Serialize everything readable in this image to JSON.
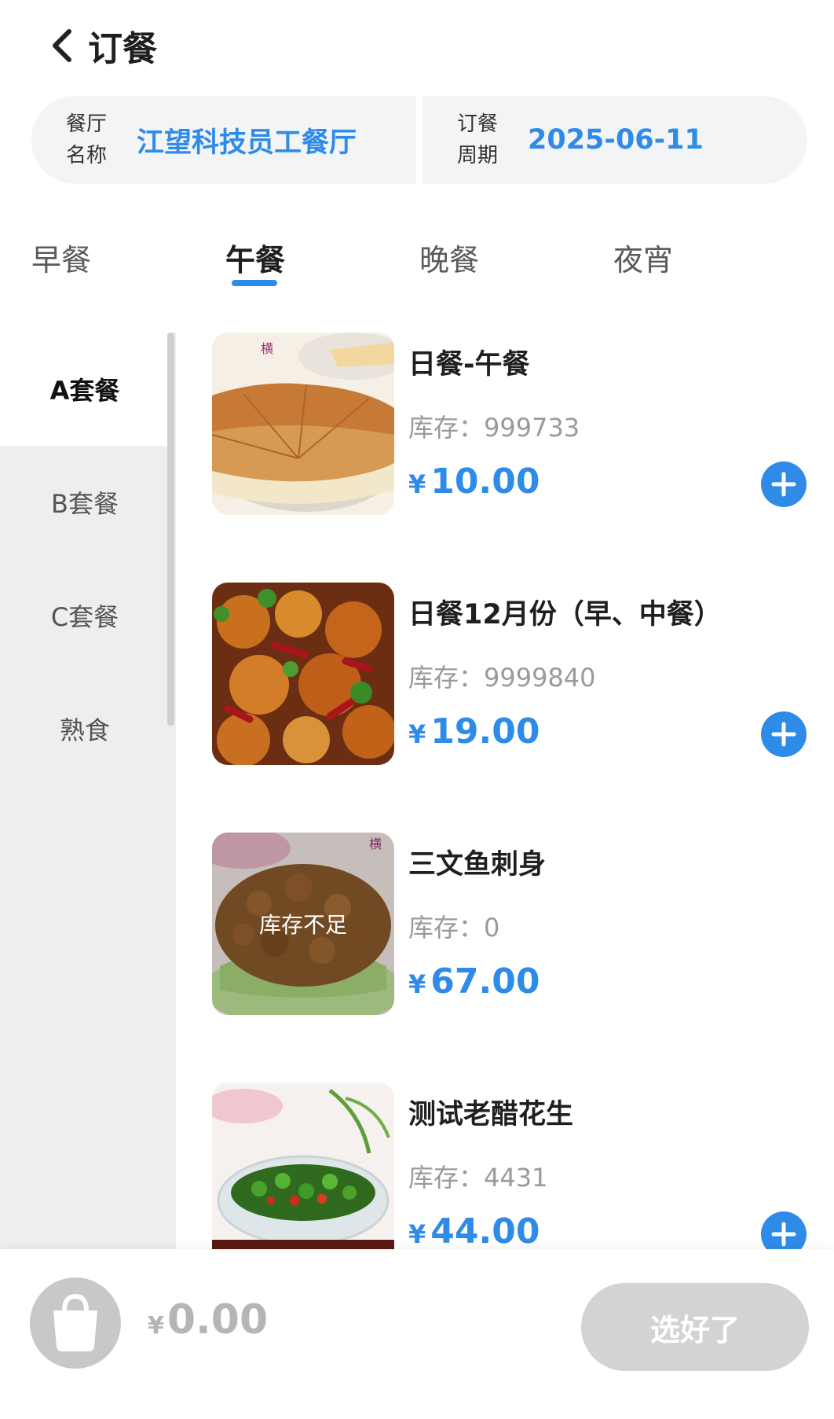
{
  "header": {
    "title": "订餐"
  },
  "info": {
    "restaurant_label": "餐厅名称",
    "restaurant_name": "江望科技员工餐厅",
    "period_label": "订餐周期",
    "period_value": "2025-06-11"
  },
  "tabs": [
    {
      "label": "早餐"
    },
    {
      "label": "午餐",
      "active": true
    },
    {
      "label": "晚餐"
    },
    {
      "label": "夜宵"
    }
  ],
  "categories": [
    {
      "label": "A套餐",
      "active": true
    },
    {
      "label": "B套餐"
    },
    {
      "label": "C套餐"
    },
    {
      "label": "熟食"
    }
  ],
  "items": [
    {
      "name": "日餐-午餐",
      "stock": "库存：999733",
      "currency": "¥",
      "price": "10.00",
      "image": "cake-photo-icon"
    },
    {
      "name": "日餐12月份（早、中餐）",
      "stock": "库存：9999840",
      "currency": "¥",
      "price": "19.00",
      "image": "fried-dish-photo-icon"
    },
    {
      "name": "三文鱼刺身",
      "stock": "库存：0",
      "currency": "¥",
      "price": "67.00",
      "image": "walnut-dish-photo-icon",
      "overlay": "库存不足"
    },
    {
      "name": "测试老醋花生",
      "stock": "库存：4431",
      "currency": "¥",
      "price": "44.00",
      "image": "pepper-bowl-photo-icon"
    }
  ],
  "footer": {
    "currency": "¥",
    "total": "0.00",
    "confirm_label": "选好了"
  },
  "colors": {
    "accent": "#2f8be8",
    "sidebar_bg": "#eeeeee",
    "disabled": "#d3d3d3"
  }
}
